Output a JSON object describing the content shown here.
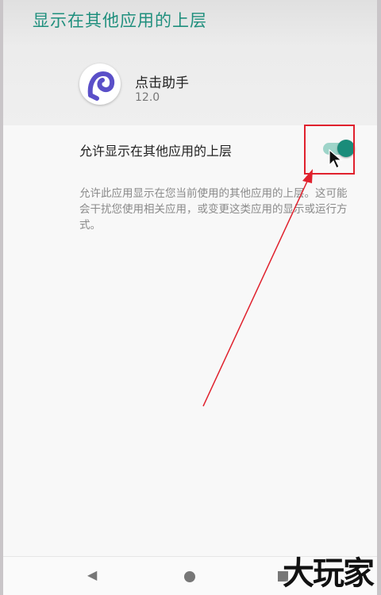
{
  "header": {
    "title": "显示在其他应用的上层"
  },
  "app": {
    "name": "点击助手",
    "version": "12.0",
    "icon": "app-logo-icon"
  },
  "setting": {
    "label": "允许显示在其他应用的上层",
    "description": "允许此应用显示在您当前使用的其他应用的上层。这可能会干扰您使用相关应用，或变更这类应用的显示或运行方式。",
    "toggle_on": true
  },
  "annotation": {
    "color": "#e0212d"
  },
  "nav": {
    "back_icon": "back-icon",
    "home_icon": "home-icon",
    "recents_icon": "recents-icon"
  },
  "watermark": {
    "text": "大玩家"
  },
  "colors": {
    "accent": "#1a8c7a",
    "title": "#1f8f7d",
    "track": "#9ed4c9"
  }
}
